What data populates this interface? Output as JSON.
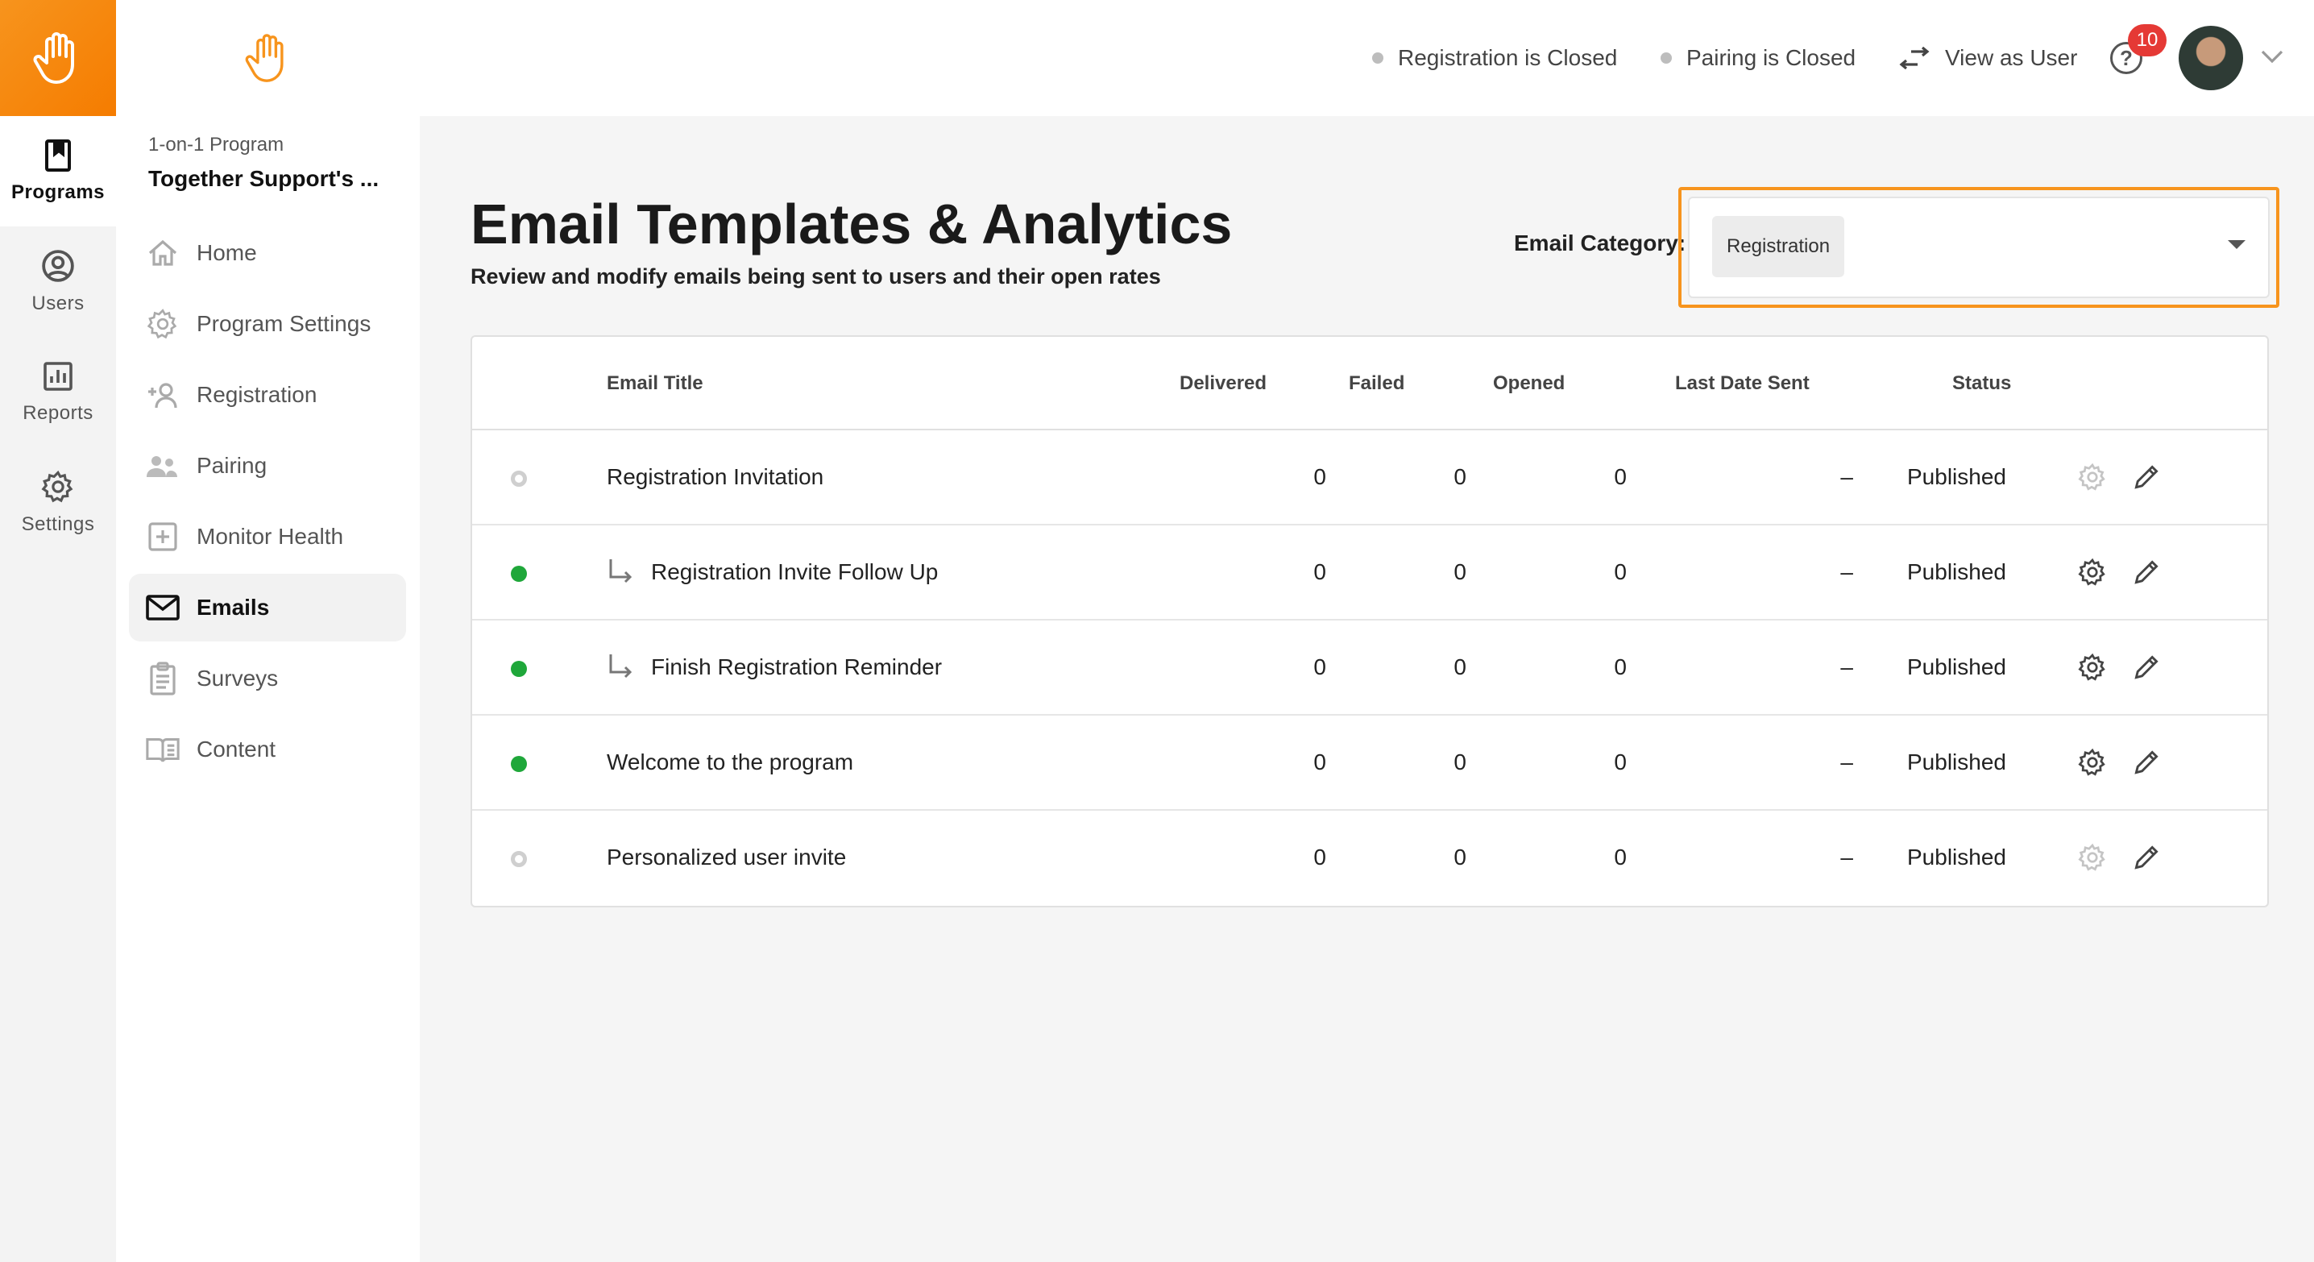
{
  "rail": {
    "items": [
      {
        "label": "Programs",
        "icon": "bookmark-icon",
        "active": true
      },
      {
        "label": "Users",
        "icon": "user-circle-icon"
      },
      {
        "label": "Reports",
        "icon": "bar-chart-icon"
      },
      {
        "label": "Settings",
        "icon": "gear-icon"
      }
    ],
    "brand_color": "#f7941d"
  },
  "sidebar": {
    "program_type": "1-on-1 Program",
    "program_name": "Together Support's ...",
    "items": [
      {
        "label": "Home",
        "icon": "home-icon"
      },
      {
        "label": "Program Settings",
        "icon": "gear-icon"
      },
      {
        "label": "Registration",
        "icon": "add-user-icon"
      },
      {
        "label": "Pairing",
        "icon": "users-icon"
      },
      {
        "label": "Monitor Health",
        "icon": "plus-square-icon"
      },
      {
        "label": "Emails",
        "icon": "mail-icon",
        "active": true
      },
      {
        "label": "Surveys",
        "icon": "clipboard-icon"
      },
      {
        "label": "Content",
        "icon": "book-icon"
      }
    ]
  },
  "topbar": {
    "registration_status": "Registration is Closed",
    "pairing_status": "Pairing is Closed",
    "view_as_user": "View as User",
    "help_symbol": "?",
    "notification_count": "10"
  },
  "main": {
    "title": "Email Templates & Analytics",
    "subtitle": "Review and modify emails being sent to users and their open rates",
    "category_label": "Email Category:",
    "category_value": "Registration",
    "columns": {
      "title": "Email Title",
      "delivered": "Delivered",
      "failed": "Failed",
      "opened": "Opened",
      "last_sent": "Last Date Sent",
      "status": "Status"
    },
    "rows": [
      {
        "title": "Registration Invitation",
        "delivered": "0",
        "failed": "0",
        "opened": "0",
        "last_sent": "–",
        "status": "Published",
        "active": false,
        "sub": false
      },
      {
        "title": "Registration Invite Follow Up",
        "delivered": "0",
        "failed": "0",
        "opened": "0",
        "last_sent": "–",
        "status": "Published",
        "active": true,
        "sub": true
      },
      {
        "title": "Finish Registration Reminder",
        "delivered": "0",
        "failed": "0",
        "opened": "0",
        "last_sent": "–",
        "status": "Published",
        "active": true,
        "sub": true
      },
      {
        "title": "Welcome to the program",
        "delivered": "0",
        "failed": "0",
        "opened": "0",
        "last_sent": "–",
        "status": "Published",
        "active": true,
        "sub": false
      },
      {
        "title": "Personalized user invite",
        "delivered": "0",
        "failed": "0",
        "opened": "0",
        "last_sent": "–",
        "status": "Published",
        "active": false,
        "sub": false
      }
    ],
    "active_color": "#1fa73a"
  }
}
